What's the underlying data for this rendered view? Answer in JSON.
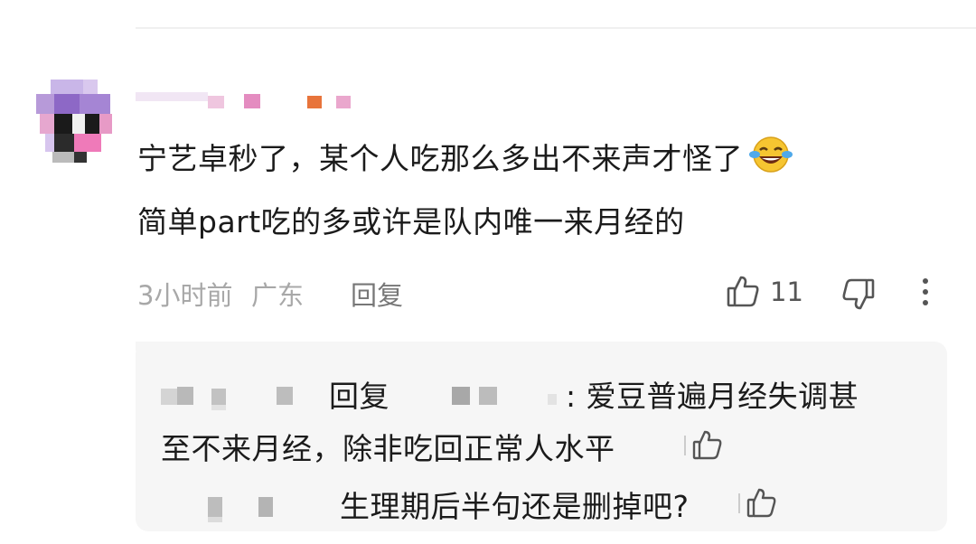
{
  "comment": {
    "text_line1": "宁艺卓秒了，某个人吃那么多出不来声才怪了",
    "text_line2": "简单part吃的多或许是队内唯一来月经的",
    "emoji": "laughing-with-tears-emoji",
    "time": "3小时前",
    "location": "广东",
    "reply_label": "回复",
    "like_count": "11",
    "icons": [
      "thumbs-up-icon",
      "thumbs-down-icon",
      "more-vertical-icon"
    ]
  },
  "replies": [
    {
      "prefix": "回复",
      "text_a": ": 爱豆普遍月经失调甚",
      "text_b": "至不来月经，除非吃回正常人水平"
    },
    {
      "text": "生理期后半句还是删掉吧?"
    }
  ],
  "colors": {
    "text": "#1b1b1b",
    "meta": "#a8a8a8",
    "reply_bg": "#f6f6f6",
    "emoji_face": "#f6c531"
  }
}
